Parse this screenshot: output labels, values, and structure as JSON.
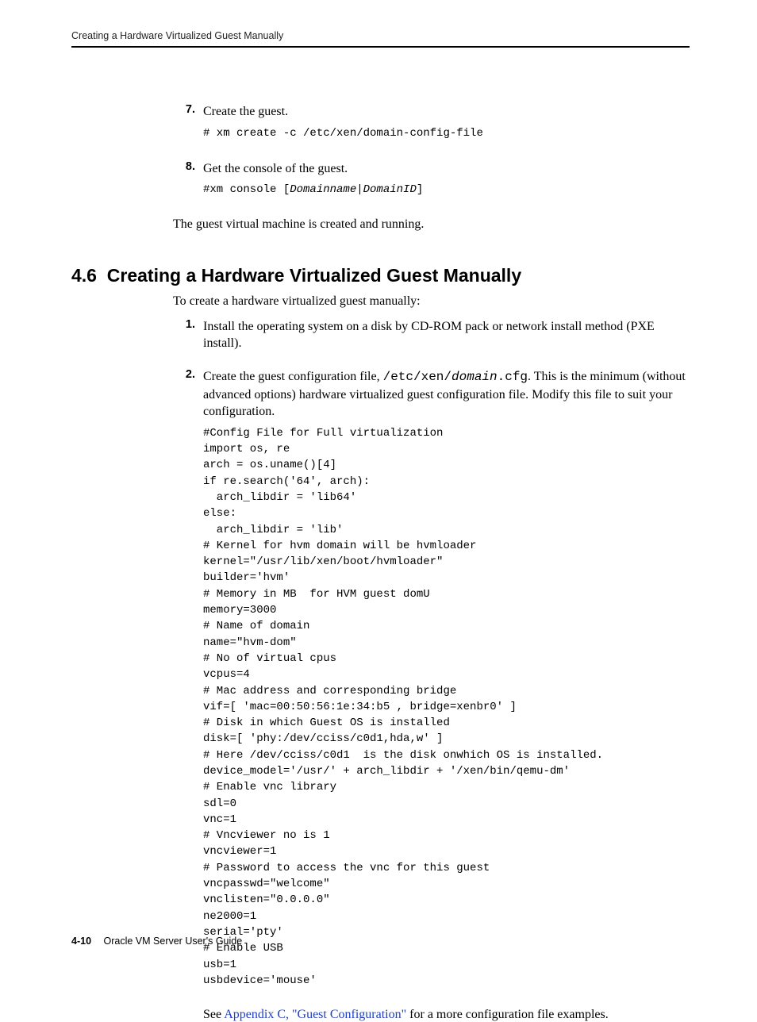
{
  "running_head": "Creating a Hardware Virtualized Guest Manually",
  "prev_steps": {
    "s7": {
      "num": "7.",
      "text": "Create the guest.",
      "code": "# xm create -c /etc/xen/domain-config-file"
    },
    "s8": {
      "num": "8.",
      "text": "Get the console of the guest.",
      "code_prefix": "#xm console [",
      "code_args": "Domainname|DomainID",
      "code_suffix": "]"
    },
    "after": "The guest virtual machine is created and running."
  },
  "section": {
    "number": "4.6",
    "title": "Creating a Hardware Virtualized Guest Manually",
    "intro": "To create a hardware virtualized guest manually:",
    "steps": {
      "s1": {
        "num": "1.",
        "text": "Install the operating system on a disk by CD-ROM pack or network install method (PXE install)."
      },
      "s2": {
        "num": "2.",
        "text_a": "Create the guest configuration file, ",
        "path_a": "/etc/xen/",
        "path_b": "domain",
        "path_c": ".cfg",
        "text_b": ". This is the minimum (without advanced options) hardware virtualized guest configuration file. Modify this file to suit your configuration.",
        "code": "#Config File for Full virtualization\nimport os, re\narch = os.uname()[4]\nif re.search('64', arch):\n  arch_libdir = 'lib64'\nelse:\n  arch_libdir = 'lib'\n# Kernel for hvm domain will be hvmloader\nkernel=\"/usr/lib/xen/boot/hvmloader\"\nbuilder='hvm'\n# Memory in MB  for HVM guest domU\nmemory=3000\n# Name of domain\nname=\"hvm-dom\"\n# No of virtual cpus\nvcpus=4\n# Mac address and corresponding bridge\nvif=[ 'mac=00:50:56:1e:34:b5 , bridge=xenbr0' ]\n# Disk in which Guest OS is installed\ndisk=[ 'phy:/dev/cciss/c0d1,hda,w' ]\n# Here /dev/cciss/c0d1  is the disk onwhich OS is installed.\ndevice_model='/usr/' + arch_libdir + '/xen/bin/qemu-dm'\n# Enable vnc library\nsdl=0\nvnc=1\n# Vncviewer no is 1\nvncviewer=1\n# Password to access the vnc for this guest\nvncpasswd=\"welcome\"\nvnclisten=\"0.0.0.0\"\nne2000=1\nserial='pty'\n# Enable USB\nusb=1\nusbdevice='mouse'",
        "see_a": "See ",
        "see_link": "Appendix C, \"Guest Configuration\"",
        "see_b": " for a more configuration file examples."
      }
    }
  },
  "footer": {
    "page_number": "4-10",
    "book_title": "Oracle VM Server User's Guide"
  }
}
